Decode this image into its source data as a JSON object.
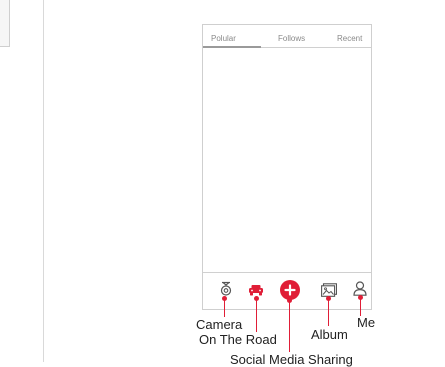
{
  "tabs": [
    {
      "label": "Polular"
    },
    {
      "label": "Follows"
    },
    {
      "label": "Recent"
    }
  ],
  "active_tab": "Polular",
  "nav_icons": [
    "camera-icon",
    "car-icon",
    "plus-icon",
    "album-icon",
    "person-icon"
  ],
  "colors": {
    "accent": "#e01e37",
    "icon_gray": "#555555",
    "border": "#cfcfcf"
  },
  "annotations": {
    "camera": "Camera",
    "on_the_road": "On The Road",
    "album": "Album",
    "me": "Me",
    "social_media_sharing": "Social Media Sharing"
  }
}
